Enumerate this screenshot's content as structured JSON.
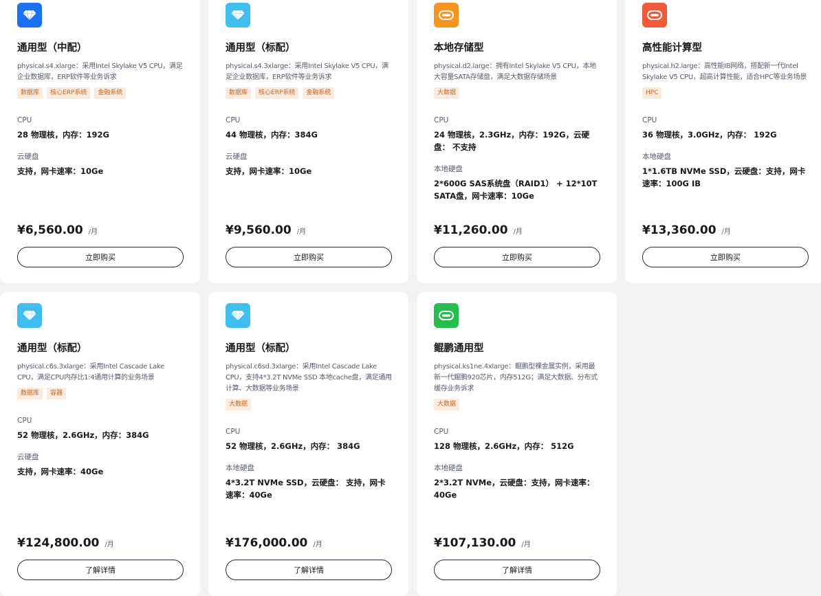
{
  "colors": {
    "icon_dark_blue": "#1b71f5",
    "icon_light_blue": "#3ebff0",
    "icon_orange": "#f7941d",
    "icon_red": "#f25a38",
    "icon_green": "#24be4d",
    "tag_bg": "#fbebdf",
    "tag_text": "#c76621"
  },
  "cards": [
    {
      "icon": "diamond-icon",
      "icon_color": "#1b71f5",
      "title": "通用型（中配）",
      "desc": "physical.s4.xlarge：采用Intel Skylake V5 CPU，满足企业数据库，ERP软件等业务诉求",
      "tags": [
        "数据库",
        "核心ERP系统",
        "金融系统"
      ],
      "cpu_label": "CPU",
      "cpu_value": "28 物理核，内存：192G",
      "disk_label": "云硬盘",
      "disk_value": "支持，网卡速率：10Ge",
      "price": "¥6,560.00",
      "unit": "/月",
      "button": "立即购买"
    },
    {
      "icon": "diamond-icon",
      "icon_color": "#3ebff0",
      "title": "通用型（标配）",
      "desc": "physical.s4.3xlarge：采用Intel Skylake V5 CPU，满足企业数据库，ERP软件等业务诉求",
      "tags": [
        "数据库",
        "核心ERP系统",
        "金融系统"
      ],
      "cpu_label": "CPU",
      "cpu_value": "44 物理核，内存：384G",
      "disk_label": "云硬盘",
      "disk_value": "支持，网卡速率：10Ge",
      "price": "¥9,560.00",
      "unit": "/月",
      "button": "立即购买"
    },
    {
      "icon": "disk-icon",
      "icon_color": "#f7941d",
      "title": "本地存储型",
      "desc": "physical.d2.large：拥有Intel Skylake V5 CPU，本地大容量SATA存储盘，满足大数据存储场景",
      "tags": [
        "大数据"
      ],
      "cpu_label": "CPU",
      "cpu_value": "24 物理核，2.3GHz，内存：192G，云硬盘： 不支持",
      "disk_label": "本地硬盘",
      "disk_value": "2*600G SAS系统盘（RAID1） + 12*10T SATA盘，网卡速率：10Ge",
      "price": "¥11,260.00",
      "unit": "/月",
      "button": "立即购买"
    },
    {
      "icon": "disk-icon",
      "icon_color": "#f25a38",
      "title": "高性能计算型",
      "desc": "physical.h2.large：高性能IB网络，搭配新一代Intel Skylake V5 CPU，超高计算性能，适合HPC等业务场景",
      "tags": [
        "HPC"
      ],
      "cpu_label": "CPU",
      "cpu_value": "36 物理核，3.0GHz，内存： 192G",
      "disk_label": "本地硬盘",
      "disk_value": "1*1.6TB NVMe SSD，云硬盘：支持，网卡速率：100G IB",
      "price": "¥13,360.00",
      "unit": "/月",
      "button": "立即购买"
    },
    {
      "icon": "diamond-icon",
      "icon_color": "#3ebff0",
      "title": "通用型（标配）",
      "desc": "physical.c6s.3xlarge：采用Intel Cascade Lake CPU，满足CPU内存比1:4通用计算的业务场景",
      "tags": [
        "数据库",
        "容器"
      ],
      "cpu_label": "CPU",
      "cpu_value": "52 物理核，2.6GHz，内存：384G",
      "disk_label": "云硬盘",
      "disk_value": "支持，网卡速率：40Ge",
      "price": "¥124,800.00",
      "unit": "/月",
      "button": "了解详情"
    },
    {
      "icon": "diamond-icon",
      "icon_color": "#3ebff0",
      "title": "通用型（标配）",
      "desc": "physical.c6sd.3xlarge：采用Intel Cascade Lake CPU，支持4*3.2T NVMe SSD 本地cache盘，满足通用计算、大数据等业务场景",
      "tags": [
        "大数据"
      ],
      "cpu_label": "CPU",
      "cpu_value": "52 物理核，2.6GHz，内存： 384G",
      "disk_label": "本地硬盘",
      "disk_value": "4*3.2T NVMe SSD，云硬盘： 支持，网卡速率：40Ge",
      "price": "¥176,000.00",
      "unit": "/月",
      "button": "了解详情"
    },
    {
      "icon": "disk-icon",
      "icon_color": "#24be4d",
      "title": "鲲鹏通用型",
      "desc": "physical.ks1ne.4xlarge：鲲鹏型裸金属实例，采用最新一代鲲鹏920芯片，内存512G；满足大数据、分布式缓存业务诉求",
      "tags": [
        "大数据"
      ],
      "cpu_label": "CPU",
      "cpu_value": "128 物理核，2.6GHz，内存： 512G",
      "disk_label": "本地硬盘",
      "disk_value": "2*3.2T NVMe，云硬盘：支持，网卡速率：40Ge",
      "price": "¥107,130.00",
      "unit": "/月",
      "button": "了解详情"
    }
  ]
}
